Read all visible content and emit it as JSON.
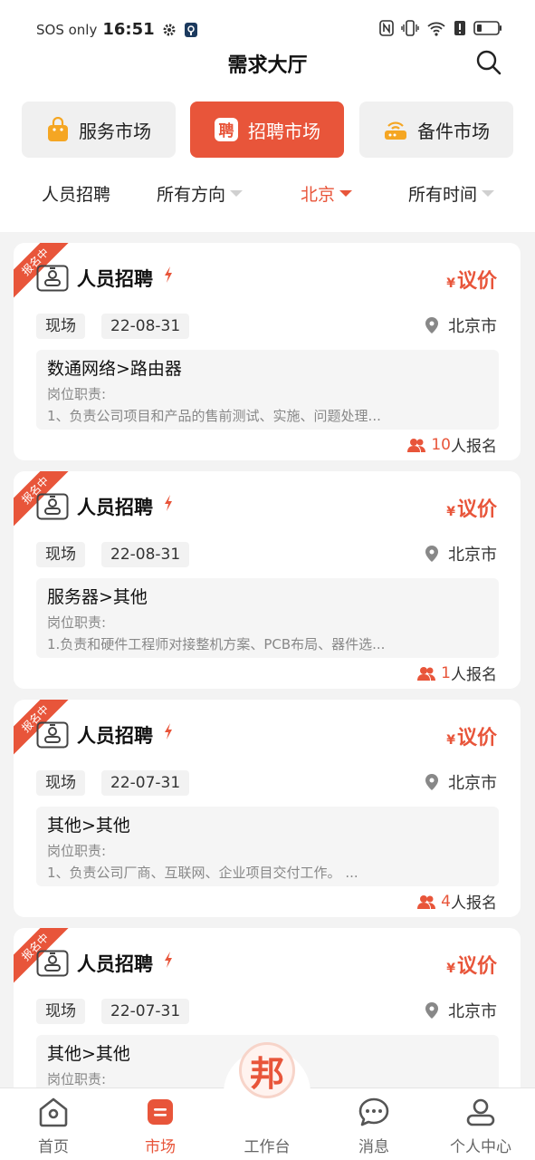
{
  "status_bar": {
    "carrier": "SOS only",
    "time": "16:51"
  },
  "header": {
    "title": "需求大厅"
  },
  "market_tabs": [
    {
      "label": "服务市场",
      "icon": "shopping-bag-icon"
    },
    {
      "label": "招聘市场",
      "icon": "recruit-icon",
      "icon_char": "聘"
    },
    {
      "label": "备件市场",
      "icon": "router-icon"
    }
  ],
  "filters": [
    {
      "label": "人员招聘"
    },
    {
      "label": "所有方向"
    },
    {
      "label": "北京"
    },
    {
      "label": "所有时间"
    }
  ],
  "cards": [
    {
      "ribbon": "报名中",
      "title": "人员招聘",
      "price_symbol": "¥",
      "price": "议价",
      "mode": "现场",
      "date": "22-08-31",
      "city": "北京市",
      "category": "数通网络>路由器",
      "duty_label": "岗位职责:",
      "duty_text": "1、负责公司项目和产品的售前测试、实施、问题处理...",
      "signup_count": "10",
      "signup_suffix": "人报名"
    },
    {
      "ribbon": "报名中",
      "title": "人员招聘",
      "price_symbol": "¥",
      "price": "议价",
      "mode": "现场",
      "date": "22-08-31",
      "city": "北京市",
      "category": "服务器>其他",
      "duty_label": "岗位职责:",
      "duty_text": "1.负责和硬件工程师对接整机方案、PCB布局、器件选...",
      "signup_count": "1",
      "signup_suffix": "人报名"
    },
    {
      "ribbon": "报名中",
      "title": "人员招聘",
      "price_symbol": "¥",
      "price": "议价",
      "mode": "现场",
      "date": "22-07-31",
      "city": "北京市",
      "category": "其他>其他",
      "duty_label": "岗位职责:",
      "duty_text": "1、负责公司厂商、互联网、企业项目交付工作。 ...",
      "signup_count": "4",
      "signup_suffix": "人报名"
    },
    {
      "ribbon": "报名中",
      "title": "人员招聘",
      "price_symbol": "¥",
      "price": "议价",
      "mode": "现场",
      "date": "22-07-31",
      "city": "北京市",
      "category": "其他>其他",
      "duty_label": "岗位职责:",
      "duty_text": "",
      "signup_count": "",
      "signup_suffix": ""
    }
  ],
  "bottom_nav": [
    {
      "label": "首页",
      "icon": "home-icon"
    },
    {
      "label": "市场",
      "icon": "market-icon"
    },
    {
      "label": "工作台",
      "icon": "workbench-logo",
      "logo_char": "邦"
    },
    {
      "label": "消息",
      "icon": "message-icon"
    },
    {
      "label": "个人中心",
      "icon": "profile-icon"
    }
  ],
  "colors": {
    "accent": "#e8553a",
    "background": "#f3f3f3",
    "card": "#ffffff"
  }
}
